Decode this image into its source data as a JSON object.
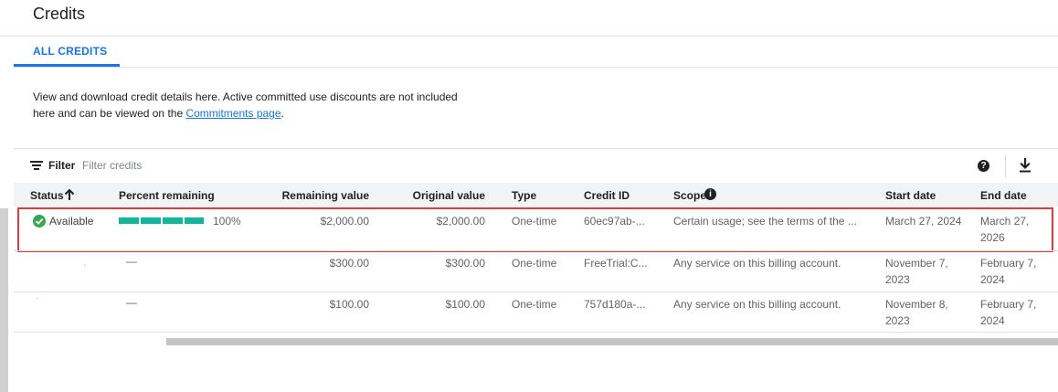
{
  "page": {
    "title": "Credits",
    "tab": "ALL CREDITS",
    "info": {
      "line1": "View and download credit details here. Active committed use discounts are not included",
      "line2": "here and can be viewed on the ",
      "link": "Commitments page",
      "end": "."
    }
  },
  "filter": {
    "label": "Filter",
    "placeholder": "Filter credits",
    "filter_icon": "filter-list-icon",
    "help_icon": "help-circle-icon",
    "download_icon": "download-icon"
  },
  "table": {
    "columns": {
      "status": "Status",
      "percent": "Percent remaining",
      "remaining": "Remaining value",
      "original": "Original value",
      "type": "Type",
      "credit_id": "Credit ID",
      "scope": "Scope",
      "start": "Start date",
      "end": "End date"
    },
    "sort_icon": "arrow-up-icon",
    "scope_info_icon": "info-icon",
    "rows": [
      {
        "status": "Available",
        "status_icon": "check-circle-icon",
        "percent": "100%",
        "percent_value": 100,
        "remaining": "$2,000.00",
        "original": "$2,000.00",
        "type": "One-time",
        "credit_id": "60ec97ab-...",
        "scope": "Certain usage; see the terms of the ...",
        "start": "March 27, 2024",
        "end": "March 27, 2026"
      },
      {
        "status": "",
        "percent": "—",
        "remaining": "$300.00",
        "original": "$300.00",
        "type": "One-time",
        "credit_id": "FreeTrial:C...",
        "scope": "Any service on this billing account.",
        "start": "November 7, 2023",
        "end": "February 7, 2024"
      },
      {
        "status": "",
        "percent": "—",
        "remaining": "$100.00",
        "original": "$100.00",
        "type": "One-time",
        "credit_id": "757d180a-...",
        "scope": "Any service on this billing account.",
        "start": "November 8, 2023",
        "end": "February 7, 2024"
      }
    ]
  },
  "colors": {
    "accent": "#1a73e8",
    "progress": "#12b5a0",
    "status_ok": "#34a853",
    "highlight": "#e53935"
  }
}
